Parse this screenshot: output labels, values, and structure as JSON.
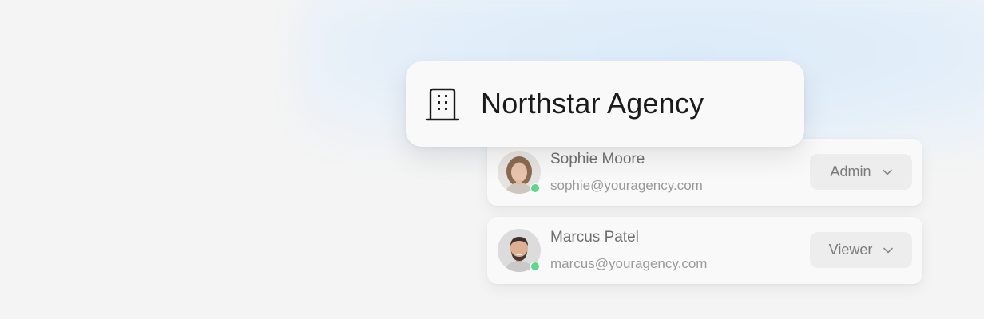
{
  "organization": {
    "name": "Northstar Agency",
    "icon": "building-icon"
  },
  "members": [
    {
      "name": "Sophie Moore",
      "email": "sophie@youragency.com",
      "role": "Admin",
      "status": "online",
      "avatar": "avatar-woman"
    },
    {
      "name": "Marcus Patel",
      "email": "marcus@youragency.com",
      "role": "Viewer",
      "status": "online",
      "avatar": "avatar-man"
    }
  ],
  "colors": {
    "background": "#f4f4f4",
    "glow": "#dcebf9",
    "status_online": "#5fd68d"
  }
}
